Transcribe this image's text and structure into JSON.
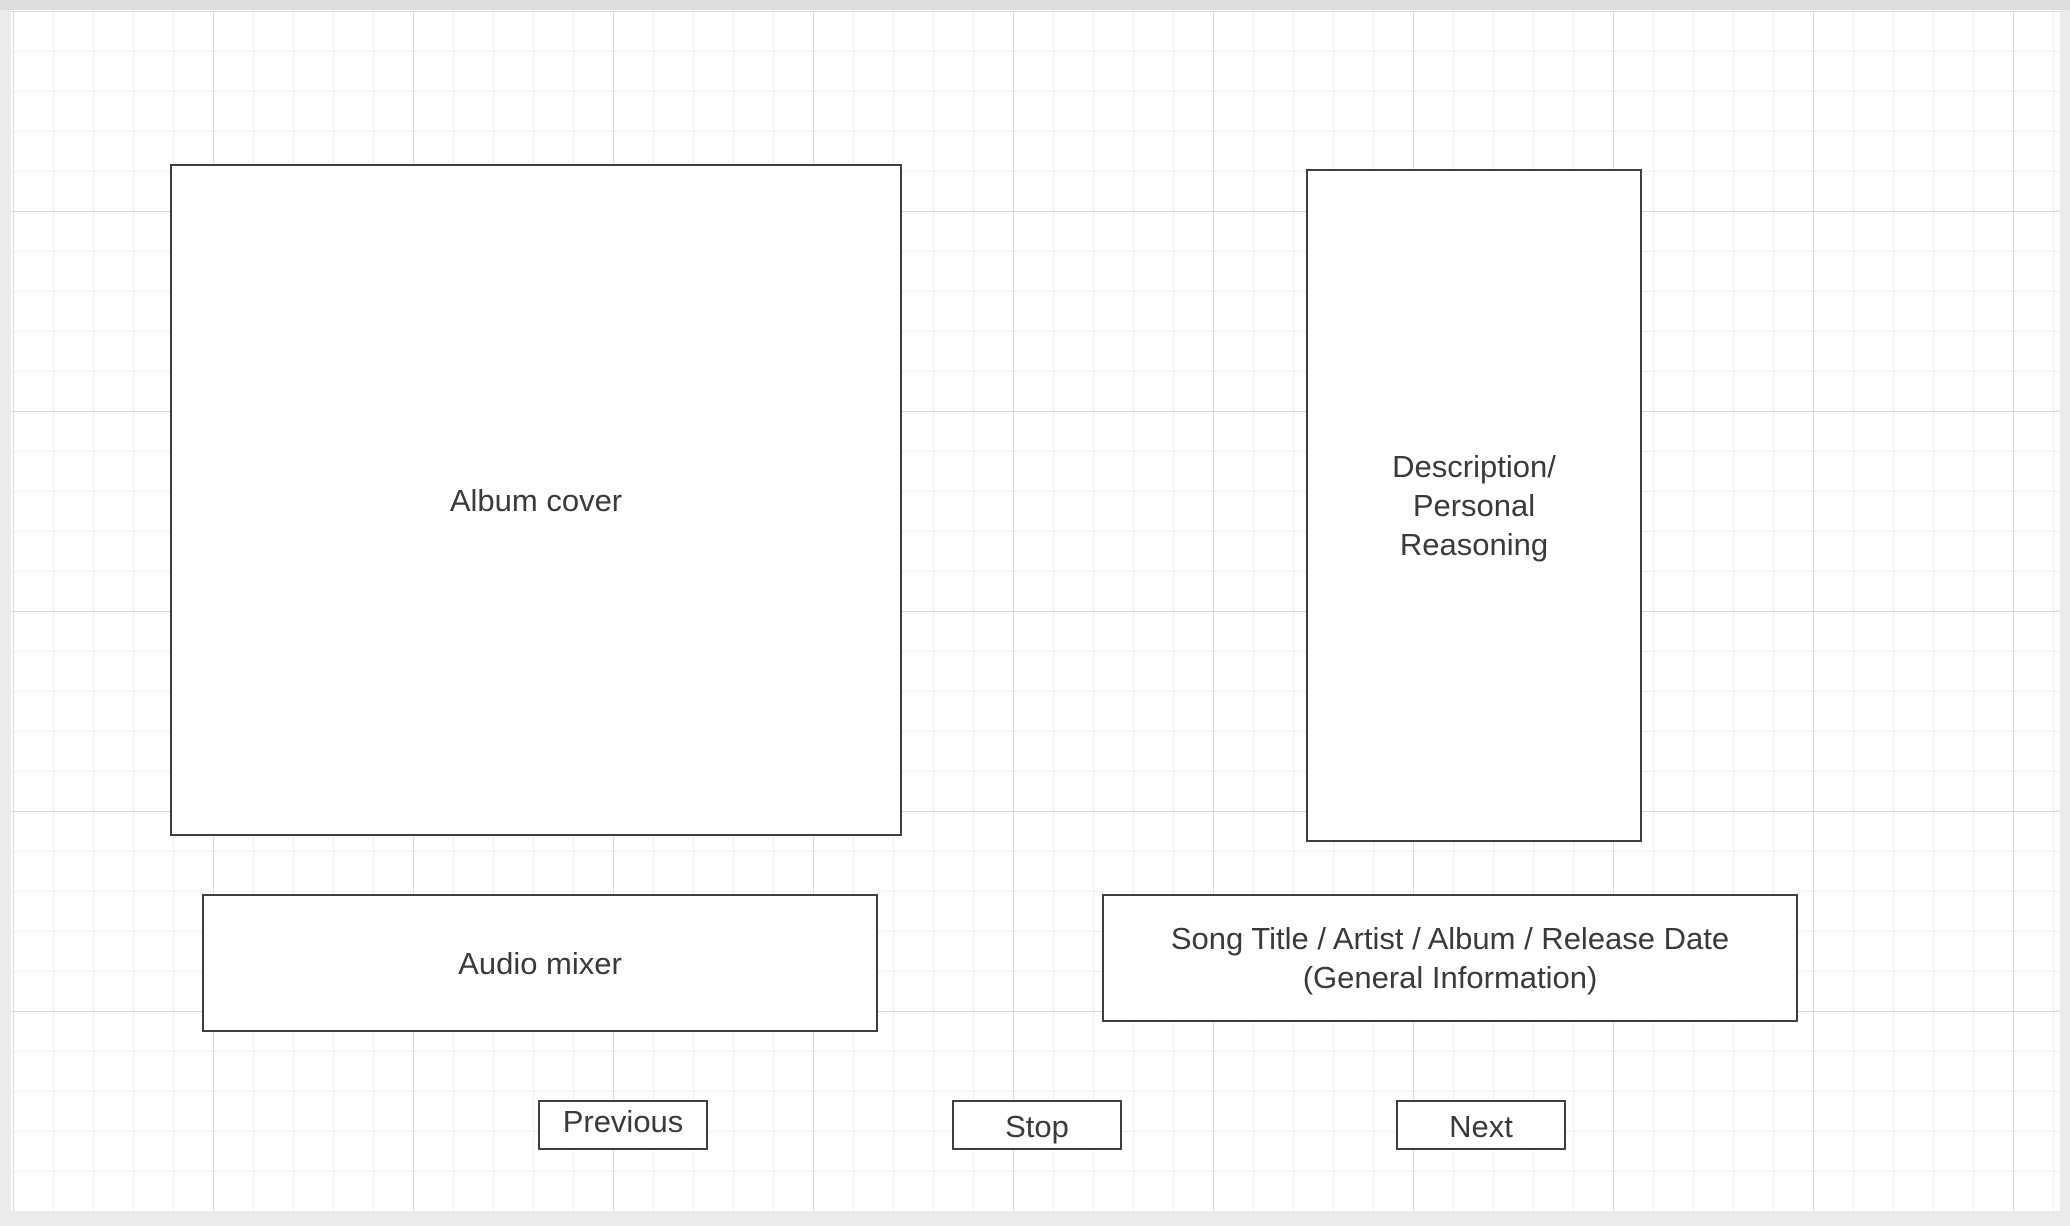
{
  "wireframe": {
    "album_cover_label": "Album cover",
    "description_label": "Description/ Personal Reasoning",
    "audio_mixer_label": "Audio mixer",
    "song_info_label": "Song Title / Artist / Album / Release Date (General Information)"
  },
  "controls": {
    "previous_label": "Previous",
    "stop_label": "Stop",
    "next_label": "Next"
  }
}
